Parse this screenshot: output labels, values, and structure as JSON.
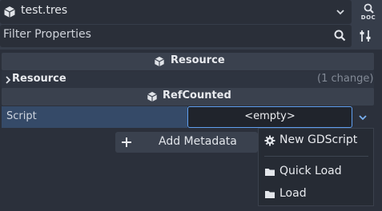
{
  "header": {
    "resource_name": "test.tres",
    "doc_button_label": "DOC"
  },
  "filter": {
    "placeholder": "Filter Properties"
  },
  "inspector": {
    "sections": [
      {
        "title": "Resource"
      },
      {
        "title": "RefCounted"
      }
    ],
    "subgroup": {
      "label": "Resource",
      "status": "(1 change)"
    },
    "property": {
      "label": "Script",
      "value": "<empty>"
    },
    "add_metadata_label": "Add Metadata"
  },
  "menu": {
    "items": [
      {
        "label": "New GDScript",
        "icon": "gear-icon"
      },
      {
        "label": "Quick Load",
        "icon": "folder-icon"
      },
      {
        "label": "Load",
        "icon": "folder-icon"
      }
    ]
  },
  "colors": {
    "accent": "#5f9ff0",
    "background": "#363d4a",
    "panel": "#2b303b",
    "label_highlight": "#354a68"
  }
}
